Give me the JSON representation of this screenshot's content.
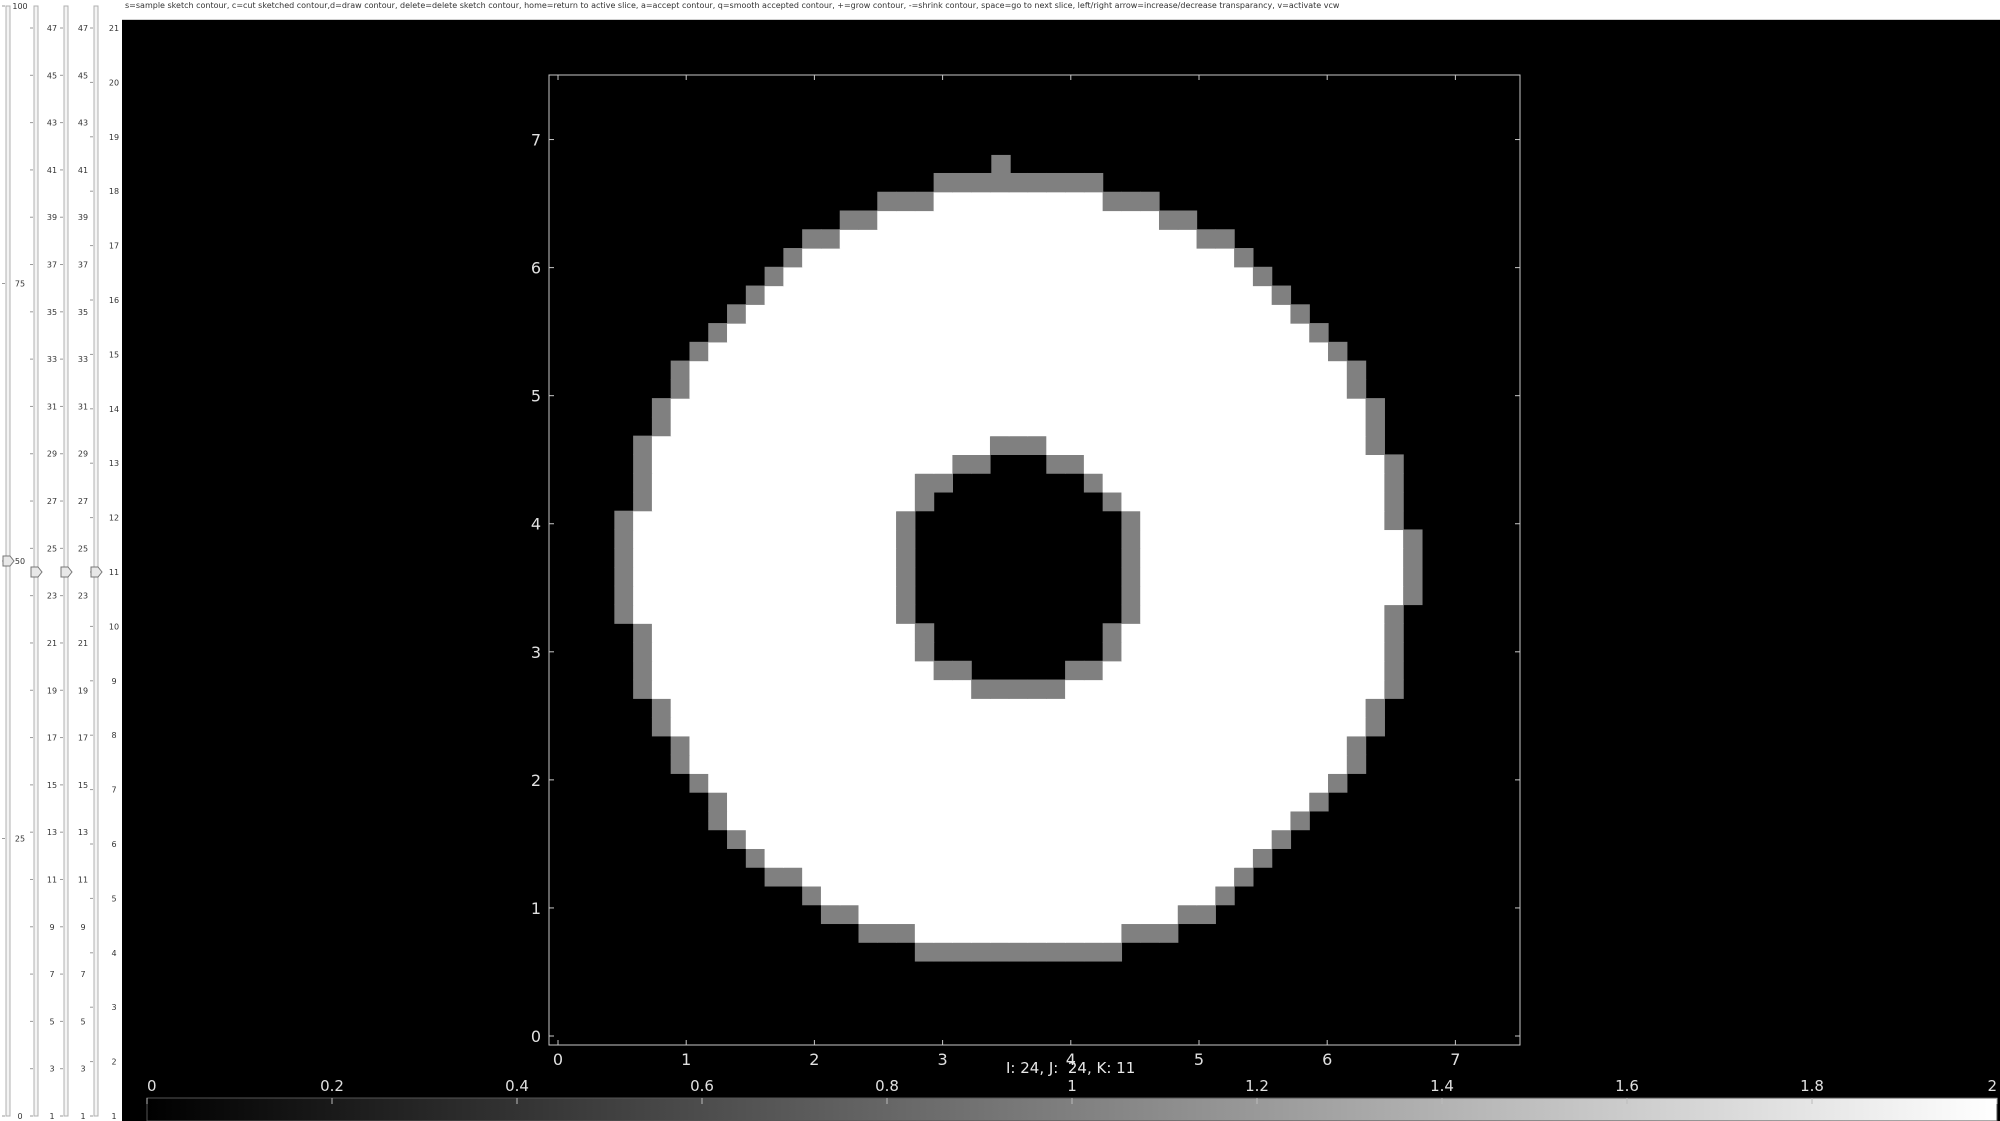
{
  "header": {
    "slice_number": "21",
    "help_text": "s=sample sketch contour, c=cut sketched contour,d=draw contour, delete=delete sketch contour, home=return to active slice, a=accept contour, q=smooth accepted contour, +=grow contour, -=shrink contour, space=go to next slice, left/right arrow=increase/decrease transparancy, v=activate vcw"
  },
  "sliders": [
    {
      "name": "transparency",
      "ticks": [
        "100",
        "75",
        "50",
        "25",
        "0"
      ],
      "value": 50
    },
    {
      "name": "window-a",
      "ticks": [
        "47",
        "45",
        "43",
        "41",
        "39",
        "37",
        "35",
        "33",
        "31",
        "29",
        "27",
        "25",
        "23",
        "21",
        "19",
        "17",
        "15",
        "13",
        "11",
        "9",
        "7",
        "5",
        "3",
        "1"
      ],
      "value": 24
    },
    {
      "name": "window-b",
      "ticks": [
        "47",
        "45",
        "43",
        "41",
        "39",
        "37",
        "35",
        "33",
        "31",
        "29",
        "27",
        "25",
        "23",
        "21",
        "19",
        "17",
        "15",
        "13",
        "11",
        "9",
        "7",
        "5",
        "3",
        "1"
      ],
      "value": 24
    },
    {
      "name": "slice",
      "ticks": [
        "21",
        "20",
        "19",
        "18",
        "17",
        "16",
        "15",
        "14",
        "13",
        "12",
        "11",
        "10",
        "9",
        "8",
        "7",
        "6",
        "5",
        "4",
        "3",
        "2",
        "1"
      ],
      "value": 11
    }
  ],
  "status": {
    "coords": "I: 24, J:  24, K: 11"
  },
  "colors": {
    "background": "#000000",
    "ring_fill": "#ffffff",
    "contour": "#808080",
    "axis": "#c8c8c8"
  },
  "chart_data": {
    "type": "heatmap",
    "x_ticks": [
      "0",
      "1",
      "2",
      "3",
      "4",
      "5",
      "6",
      "7"
    ],
    "y_ticks": [
      "0",
      "1",
      "2",
      "3",
      "4",
      "5",
      "6",
      "7"
    ],
    "xlim": [
      0,
      7.3
    ],
    "ylim": [
      0,
      7.3
    ],
    "pixel_size": 0.1465,
    "grid": false,
    "outer_contour": {
      "center": [
        3.58,
        3.65
      ],
      "radius": 2.95,
      "value": 1
    },
    "inner_contour": {
      "center": [
        3.58,
        3.65
      ],
      "radius": 1.0,
      "value": 1
    },
    "ring_value": 2,
    "colorbar": {
      "ticks": [
        "0",
        "0.2",
        "0.4",
        "0.6",
        "0.8",
        "1",
        "1.2",
        "1.4",
        "1.6",
        "1.8",
        "2"
      ],
      "range": [
        0,
        2
      ]
    }
  }
}
